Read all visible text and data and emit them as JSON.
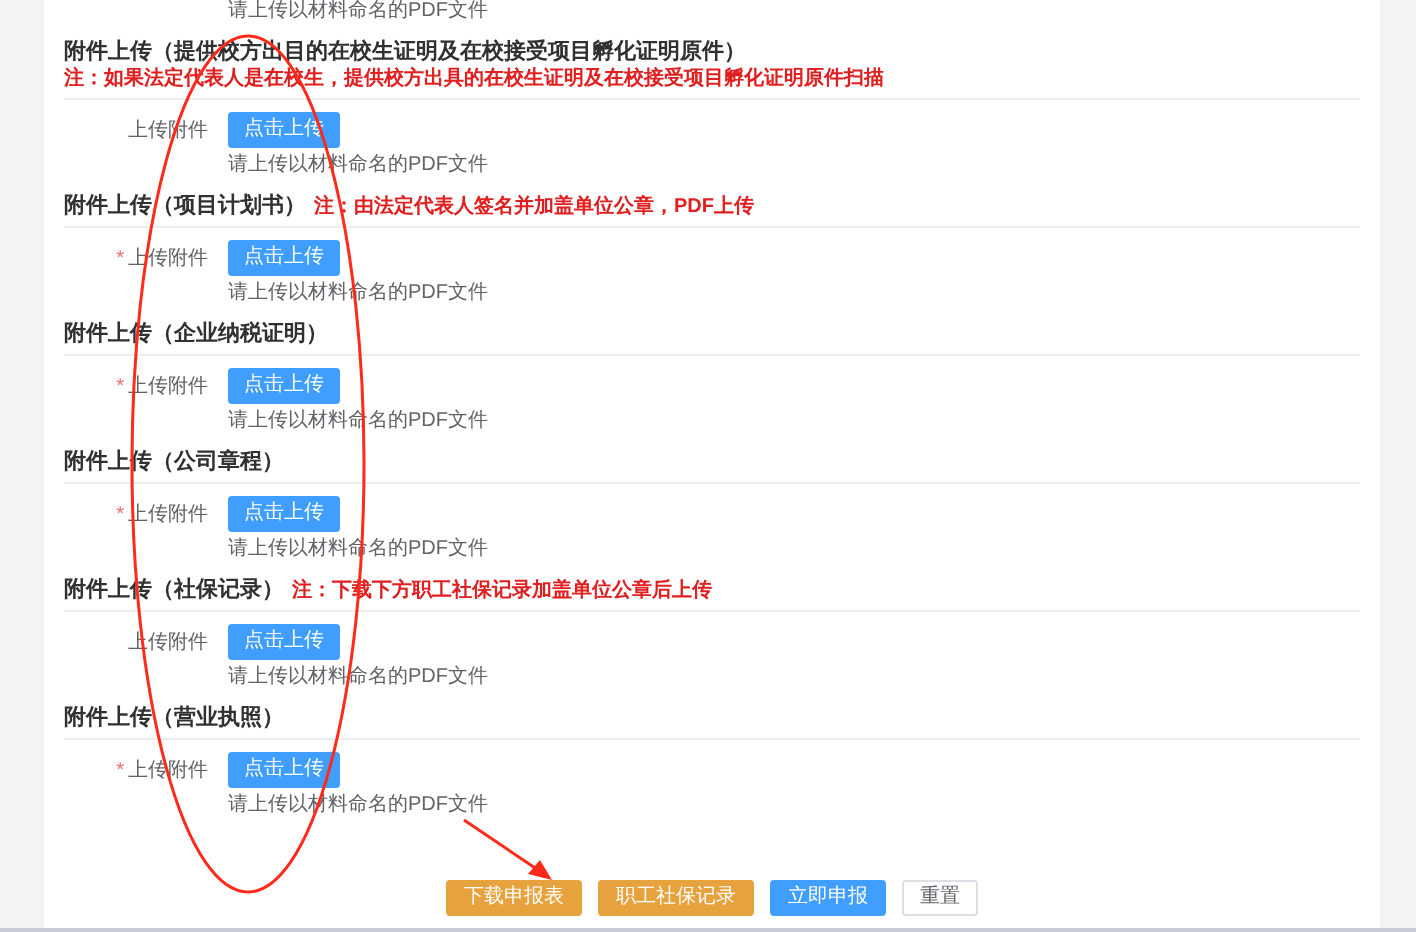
{
  "top_hint": "请上传以材料命名的PDF文件",
  "required_mark": "*",
  "sections": [
    {
      "title": "附件上传（提供校方出目的在校生证明及在校接受项目孵化证明原件）",
      "note": "注：如果法定代表人是在校生，提供校方出具的在校生证明及在校接受项目孵化证明原件扫描",
      "label": "上传附件",
      "required": false,
      "button": "点击上传",
      "hint": "请上传以材料命名的PDF文件"
    },
    {
      "title": "附件上传（项目计划书）",
      "note": "注：由法定代表人签名并加盖单位公章，PDF上传",
      "label": "上传附件",
      "required": true,
      "button": "点击上传",
      "hint": "请上传以材料命名的PDF文件"
    },
    {
      "title": "附件上传（企业纳税证明）",
      "label": "上传附件",
      "required": true,
      "button": "点击上传",
      "hint": "请上传以材料命名的PDF文件"
    },
    {
      "title": "附件上传（公司章程）",
      "label": "上传附件",
      "required": true,
      "button": "点击上传",
      "hint": "请上传以材料命名的PDF文件"
    },
    {
      "title": "附件上传（社保记录）",
      "note": "注：下载下方职工社保记录加盖单位公章后上传",
      "label": "上传附件",
      "required": false,
      "button": "点击上传",
      "hint": "请上传以材料命名的PDF文件"
    },
    {
      "title": "附件上传（营业执照）",
      "label": "上传附件",
      "required": true,
      "button": "点击上传",
      "hint": "请上传以材料命名的PDF文件"
    }
  ],
  "actions": [
    {
      "label": "下载申报表",
      "kind": "warning"
    },
    {
      "label": "职工社保记录",
      "kind": "warning"
    },
    {
      "label": "立即申报",
      "kind": "primary"
    },
    {
      "label": "重置",
      "kind": "plain"
    }
  ]
}
